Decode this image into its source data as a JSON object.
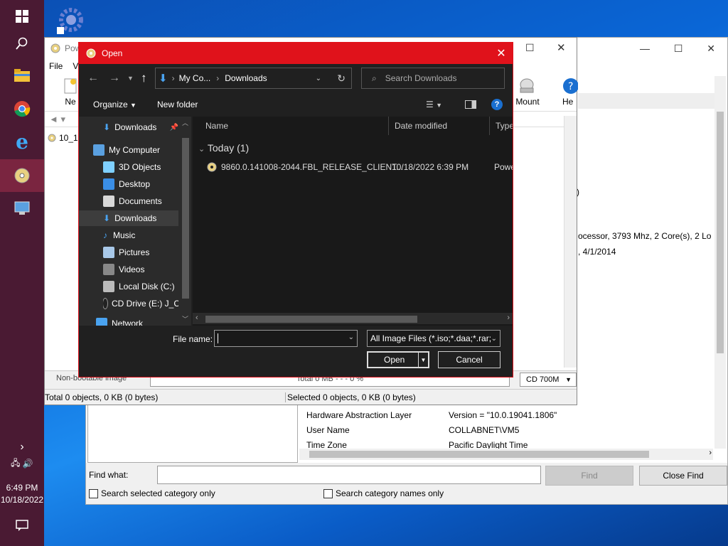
{
  "taskbar": {
    "time": "6:49 PM",
    "date": "10/18/2022"
  },
  "poweriso": {
    "title": "Pow",
    "menu": [
      "File",
      "Vi"
    ],
    "toolbar": {
      "new": "Ne",
      "mount": "Mount",
      "help": "He"
    },
    "tree_item": "10_1",
    "bootable": "Non-bootable image",
    "total": "Total 0 MB  - - - 0 %",
    "capacity": "CD 700M",
    "status_left": "Total 0 objects, 0 KB (0 bytes)",
    "status_right": "Selected 0 objects, 0 KB (0 bytes)"
  },
  "sysinfo": {
    "snippet1": ")",
    "snippet2": "ocessor, 3793 Mhz, 2 Core(s), 2 Lo",
    "snippet3": ", 4/1/2014",
    "rows": [
      {
        "k": "Hardware Abstraction Layer",
        "v": "Version = \"10.0.19041.1806\""
      },
      {
        "k": "User Name",
        "v": "COLLABNET\\VM5"
      },
      {
        "k": "Time Zone",
        "v": "Pacific Daylight Time"
      }
    ],
    "find_label": "Find what:",
    "find_btn": "Find",
    "close_find": "Close Find",
    "chk1": "Search selected category only",
    "chk2": "Search category names only"
  },
  "dialog": {
    "title": "Open",
    "breadcrumb": [
      "My Co...",
      "Downloads"
    ],
    "search_placeholder": "Search Downloads",
    "organize": "Organize",
    "new_folder": "New folder",
    "tree": [
      {
        "label": "Downloads",
        "icon": "download-icon",
        "color": "#4aa3f0"
      },
      {
        "label": "My Computer",
        "icon": "computer-icon",
        "color": "#5aa0e0"
      },
      {
        "label": "3D Objects",
        "icon": "cube-icon",
        "color": "#7fd0ff"
      },
      {
        "label": "Desktop",
        "icon": "desktop-icon",
        "color": "#3a8ee6"
      },
      {
        "label": "Documents",
        "icon": "document-icon",
        "color": "#d8d8d8"
      },
      {
        "label": "Downloads",
        "icon": "download-icon",
        "color": "#4aa3f0"
      },
      {
        "label": "Music",
        "icon": "music-icon",
        "color": "#4aa3f0"
      },
      {
        "label": "Pictures",
        "icon": "pictures-icon",
        "color": "#a8c8e8"
      },
      {
        "label": "Videos",
        "icon": "video-icon",
        "color": "#888888"
      },
      {
        "label": "Local Disk (C:)",
        "icon": "disk-icon",
        "color": "#bbbbbb"
      },
      {
        "label": "CD Drive (E:) J_C",
        "icon": "cd-icon",
        "color": "#e0c060"
      },
      {
        "label": "Network",
        "icon": "network-icon",
        "color": "#4aa3f0"
      }
    ],
    "columns": {
      "name": "Name",
      "date": "Date modified",
      "type": "Type"
    },
    "group": "Today (1)",
    "file": {
      "name": "9860.0.141008-2044.FBL_RELEASE_CLIENT...",
      "date": "10/18/2022 6:39 PM",
      "type": "Powe"
    },
    "filename_label": "File name:",
    "filename_value": "",
    "filter": "All Image Files (*.iso;*.daa;*.rar;",
    "open": "Open",
    "cancel": "Cancel",
    "accent": "#e0121b"
  }
}
